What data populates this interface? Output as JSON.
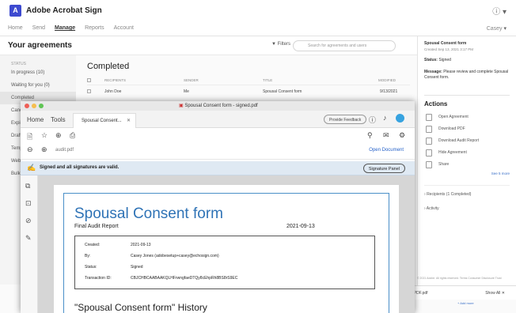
{
  "sign": {
    "app_title": "Adobe Acrobat Sign",
    "nav": [
      "Home",
      "Send",
      "Manage",
      "Reports",
      "Account"
    ],
    "user": "Casey",
    "agreements_title": "Your agreements",
    "filters_label": "Filters",
    "search_placeholder": "Search for agreements and users",
    "status_header": "STATUS",
    "status_items": [
      "In progress (10)",
      "Waiting for you (0)",
      "Completed",
      "Canceled",
      "Expired",
      "Draft",
      "Templates",
      "Web forms",
      "Bulk Send"
    ],
    "completed_title": "Completed",
    "columns": [
      "RECIPIENTS",
      "SENDER",
      "TITLE",
      "MODIFIED"
    ],
    "row": {
      "recipient": "John Doe",
      "sender": "Me",
      "title": "Spousal Consent form",
      "modified": "9/13/2021"
    },
    "panel": {
      "title": "Spousal Consent form",
      "created": "Created Sep 13, 2021 3:17 PM",
      "status_label": "Status:",
      "status_value": "Signed",
      "message_label": "Message:",
      "message_value": "Please review and complete Spousal Consent form.",
      "actions_title": "Actions",
      "actions": [
        "Open Agreement",
        "Download PDF",
        "Download Audit Report",
        "Hide Agreement",
        "Share"
      ],
      "see_more": "See 5 more",
      "recipients": "Recipients (1 Completed)",
      "activity": "Activity"
    },
    "footer": "© 2021 Adobe. All rights reserved.  Terms  Consumer Disclosure  Trust",
    "download_file": "_PDF.pdf",
    "show_all": "Show All",
    "add_more": "+ Add more"
  },
  "acrobat": {
    "window_title": "Spousal Consent form - signed.pdf",
    "tab_home": "Home",
    "tab_tools": "Tools",
    "tab_doc": "Spousal Consent...",
    "feedback": "Provide Feedback",
    "search_text": "audit.pdf",
    "open_document": "Open Document",
    "sig_message": "Signed and all signatures are valid.",
    "signature_panel": "Signature Panel",
    "doc_title": "Spousal Consent form",
    "audit_label": "Final Audit Report",
    "audit_date": "2021-09-13",
    "info": [
      {
        "k": "Created:",
        "v": "2021-09-13"
      },
      {
        "k": "By:",
        "v": "Casey Jones (adobesetup+casey@echosign.com)"
      },
      {
        "k": "Status:",
        "v": "Signed"
      },
      {
        "k": "Transaction ID:",
        "v": "CBJCHBCAABAAKQLHFrwngfaeDTQy8cEhpRh8BS8rS9EC"
      }
    ],
    "history": "\"Spousal Consent form\" History"
  }
}
